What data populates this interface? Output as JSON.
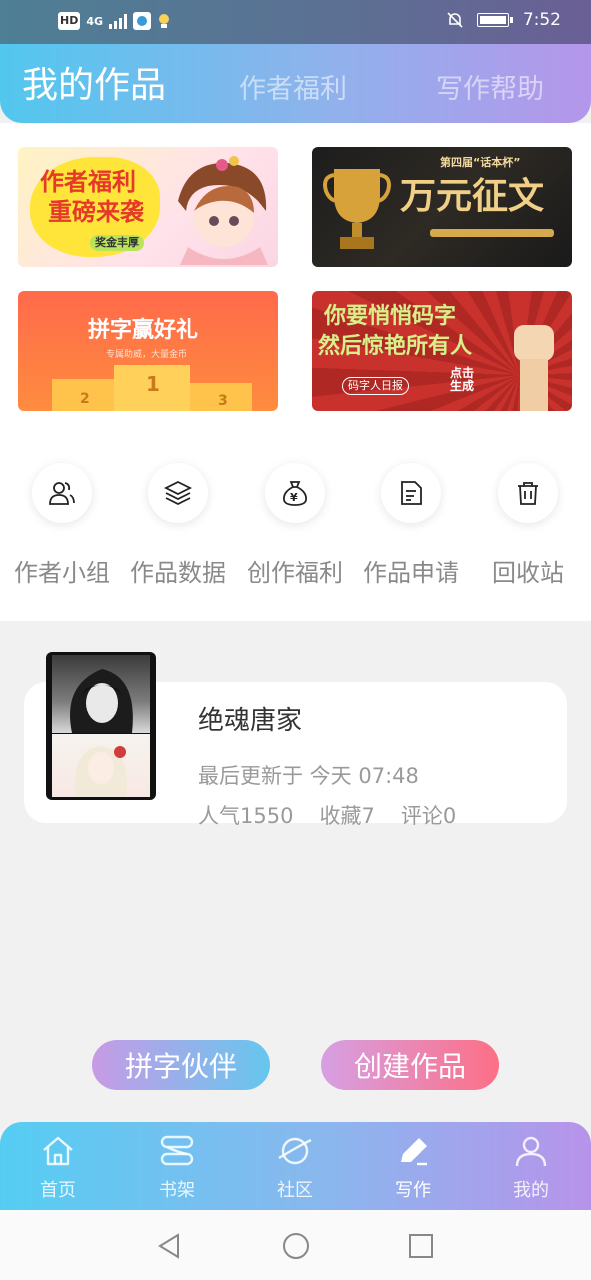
{
  "statusbar": {
    "time": "7:52",
    "hd": "HD",
    "network": "4G"
  },
  "header": {
    "tabs": [
      {
        "label": "我的作品",
        "active": true
      },
      {
        "label": "作者福利",
        "active": false
      },
      {
        "label": "写作帮助",
        "active": false
      }
    ]
  },
  "banners": {
    "b1": {
      "line1": "作者福利",
      "line2": "重磅来袭",
      "tag": "奖金丰厚"
    },
    "b2": {
      "title": "第四届“话本杯”",
      "headline": "万元征文"
    },
    "b3": {
      "headline": "拼字赢好礼",
      "sub": "专属助威，大量金币"
    },
    "b4": {
      "line1": "你要悄悄码字",
      "line2": "然后惊艳所有人",
      "tag": "码字人日报",
      "cta": "点击生成"
    }
  },
  "shortcuts": [
    {
      "label": "作者小组",
      "icon": "group-icon"
    },
    {
      "label": "作品数据",
      "icon": "layers-icon"
    },
    {
      "label": "创作福利",
      "icon": "money-bag-icon"
    },
    {
      "label": "作品申请",
      "icon": "document-icon"
    },
    {
      "label": "回收站",
      "icon": "trash-icon"
    }
  ],
  "work": {
    "title": "绝魂唐家",
    "updated": "最后更新于 今天 07:48",
    "popularity": "人气1550",
    "favorites": "收藏7",
    "comments": "评论0"
  },
  "actions": {
    "partner": "拼字伙伴",
    "create": "创建作品"
  },
  "bottom_nav": [
    {
      "label": "首页",
      "icon": "home-icon"
    },
    {
      "label": "书架",
      "icon": "bookshelf-icon"
    },
    {
      "label": "社区",
      "icon": "planet-icon"
    },
    {
      "label": "写作",
      "icon": "pen-icon",
      "active": true
    },
    {
      "label": "我的",
      "icon": "user-icon"
    }
  ],
  "colors": {
    "accent_start": "#52c7ee",
    "accent_end": "#b596ea",
    "create_end": "#fd6f86"
  }
}
